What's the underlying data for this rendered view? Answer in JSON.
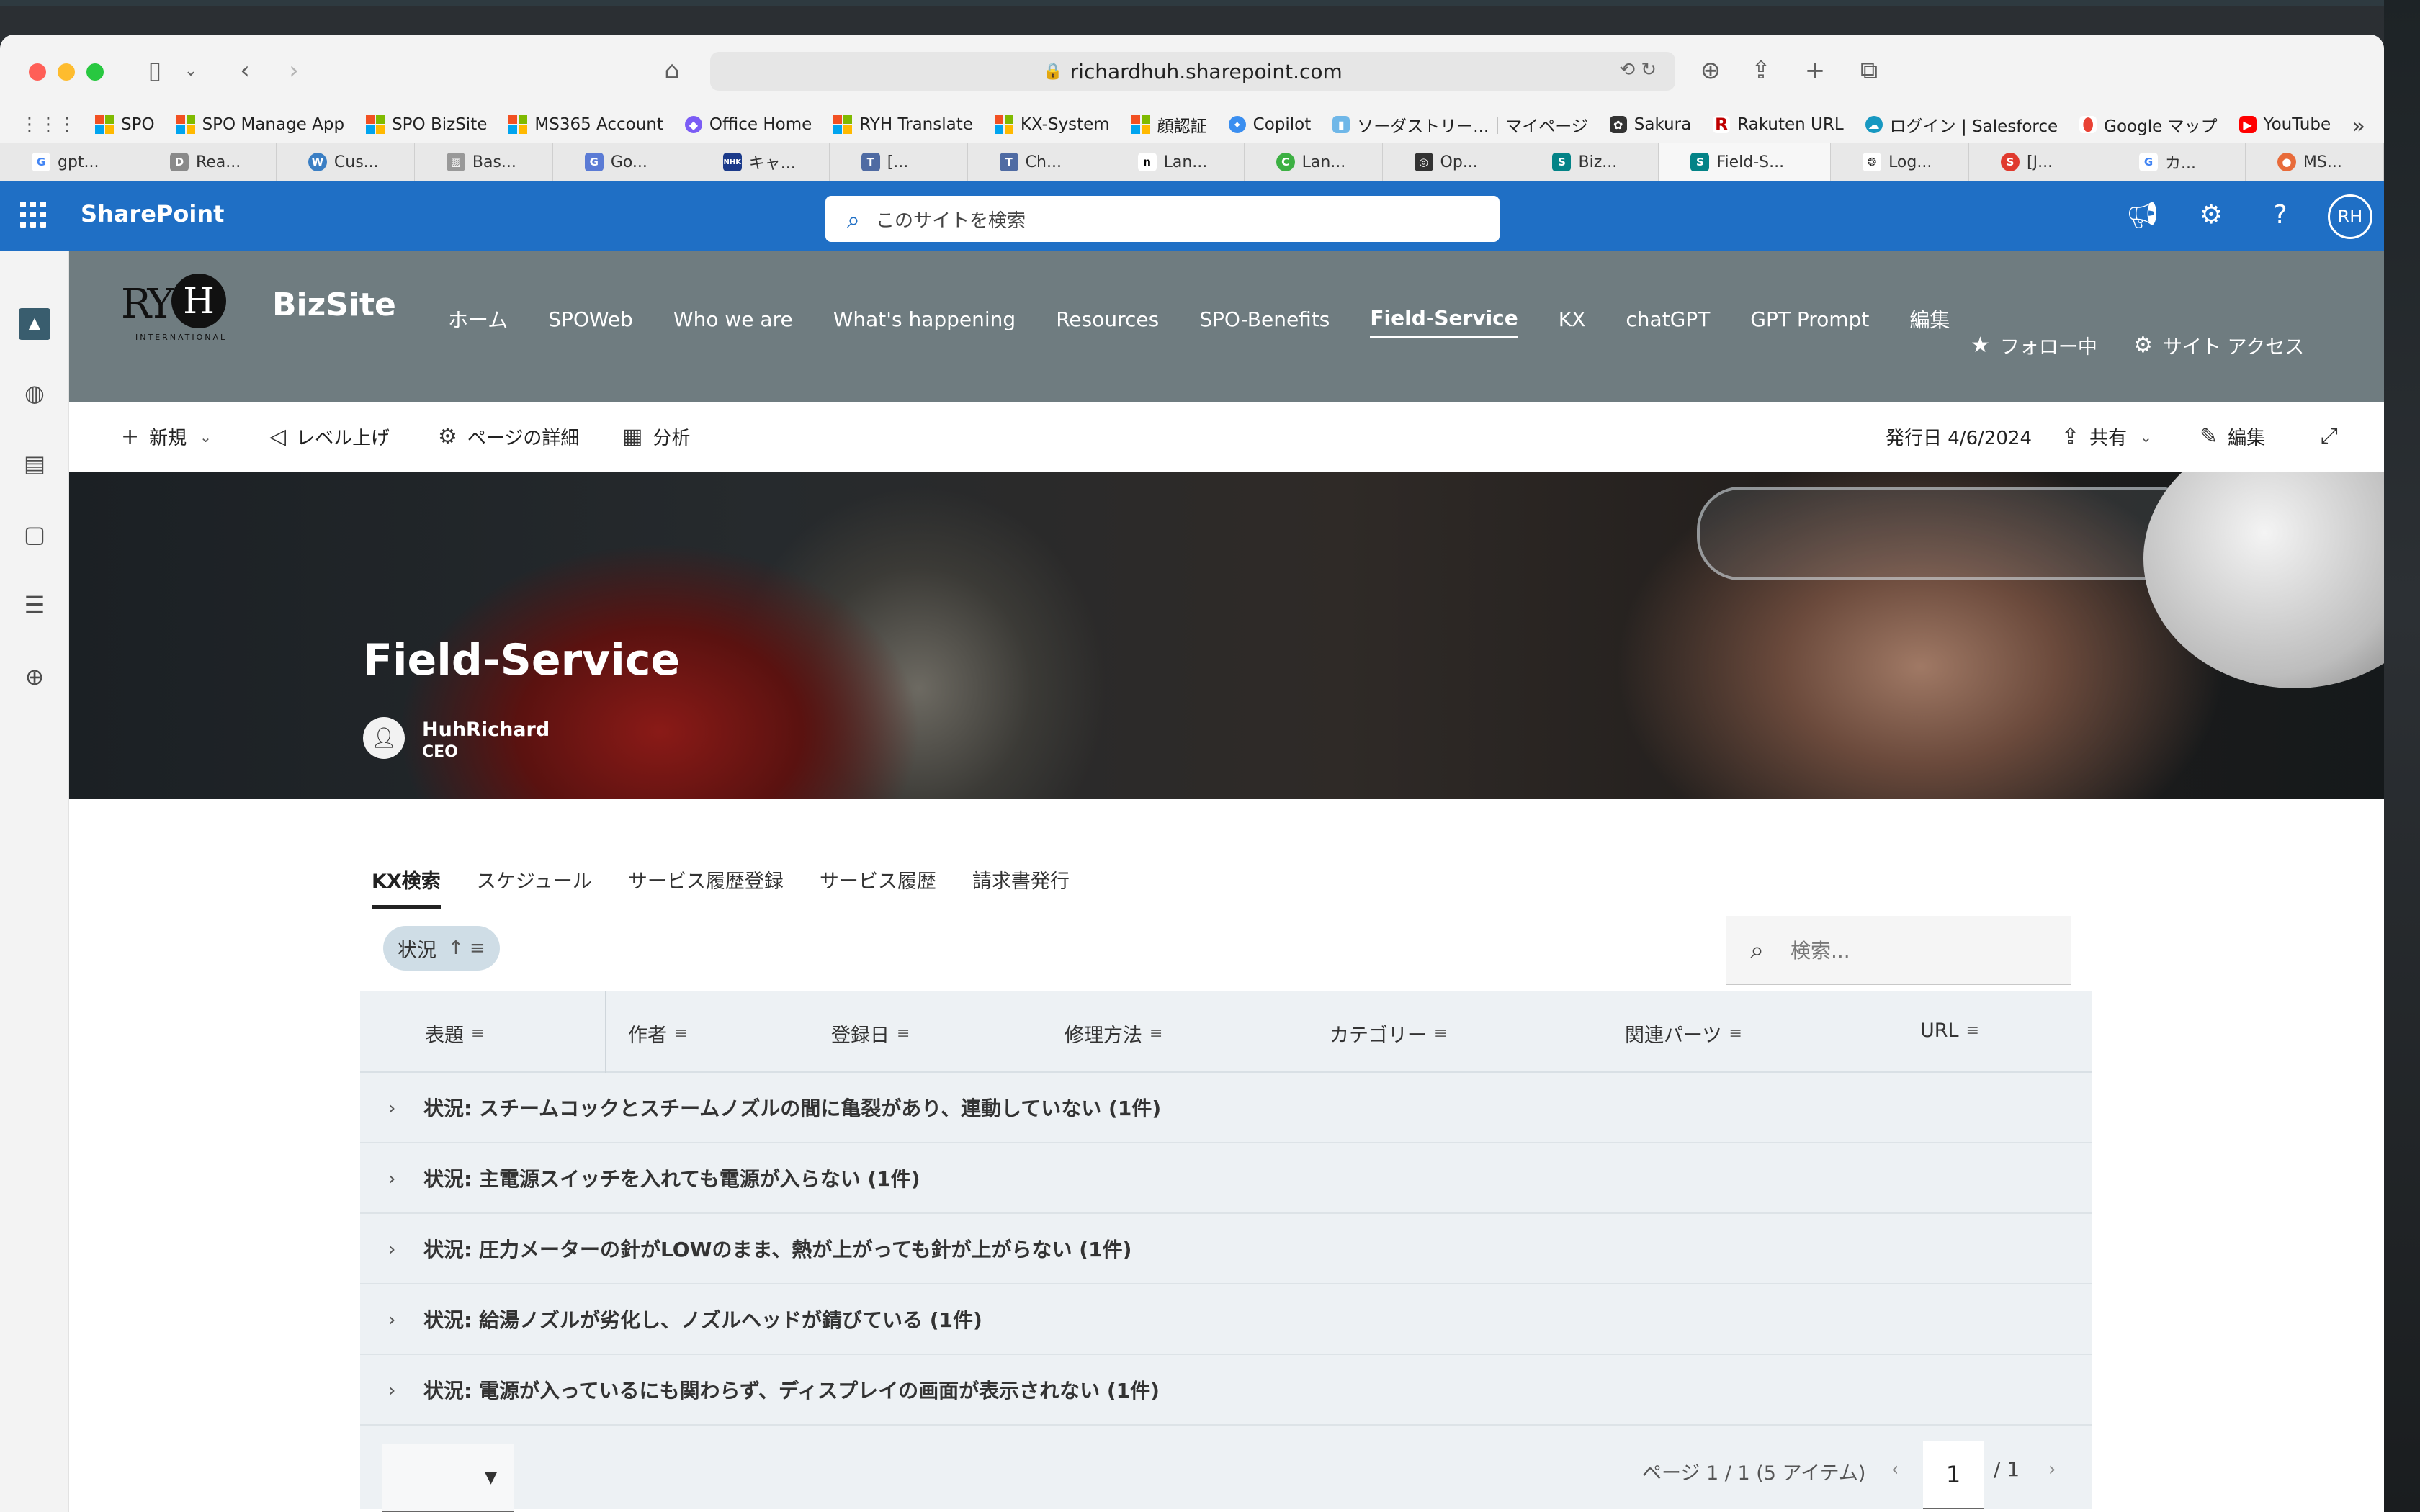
{
  "browser": {
    "url": "richardhuh.sharepoint.com",
    "bookmarks": [
      "SPO",
      "SPO Manage App",
      "SPO BizSite",
      "MS365 Account",
      "Office Home",
      "RYH Translate",
      "KX-System",
      "顔認証",
      "Copilot",
      "ソーダストリー...｜マイページ",
      "Sakura",
      "Rakuten URL",
      "ログイン | Salesforce",
      "Google マップ",
      "YouTube"
    ],
    "tabs": [
      "gpt...",
      "Rea...",
      "Cus...",
      "Bas...",
      "Go...",
      "キャ...",
      "[...",
      "Ch...",
      "Lan...",
      "Lan...",
      "Op...",
      "Biz...",
      "Field-S...",
      "Log...",
      "[J...",
      "カ...",
      "MS..."
    ],
    "active_tab_index": 12
  },
  "suite": {
    "brand": "SharePoint",
    "search_placeholder": "このサイトを検索",
    "user_initials": "RH"
  },
  "site": {
    "logo_text": "RY",
    "logo_letter": "H",
    "logo_subtext": "INTERNATIONAL",
    "title": "BizSite",
    "nav": [
      "ホーム",
      "SPOWeb",
      "Who we are",
      "What's happening",
      "Resources",
      "SPO-Benefits",
      "Field-Service",
      "KX",
      "chatGPT",
      "GPT Prompt",
      "編集"
    ],
    "active_nav_index": 6,
    "follow_label": "フォロー中",
    "site_access_label": "サイト アクセス"
  },
  "commands": {
    "new": "新規",
    "promote": "レベル上げ",
    "page_details": "ページの詳細",
    "analytics": "分析",
    "published": "発行日 4/6/2024",
    "share": "共有",
    "edit": "編集"
  },
  "hero": {
    "title": "Field-Service",
    "author_name": "HuhRichard",
    "author_role": "CEO"
  },
  "pivots": [
    "KX検索",
    "スケジュール",
    "サービス履歴登録",
    "サービス履歴",
    "請求書発行"
  ],
  "list": {
    "group_chip": "状況",
    "search_placeholder": "検索...",
    "columns": [
      "表題",
      "作者",
      "登録日",
      "修理方法",
      "カテゴリー",
      "関連パーツ",
      "URL"
    ],
    "groups": [
      "状況: スチームコックとスチームノズルの間に亀裂があり、連動していない (1件)",
      "状況: 主電源スイッチを入れても電源が入らない (1件)",
      "状況: 圧力メーターの針がLOWのまま、熱が上がっても針が上がらない (1件)",
      "状況: 給湯ノズルが劣化し、ノズルヘッドが錆びている (1件)",
      "状況: 電源が入っているにも関わらず、ディスプレイの画面が表示されない (1件)"
    ],
    "pager_text": "ページ 1 / 1 (5 アイテム)",
    "current_page": "1",
    "total_pages": "/ 1"
  }
}
